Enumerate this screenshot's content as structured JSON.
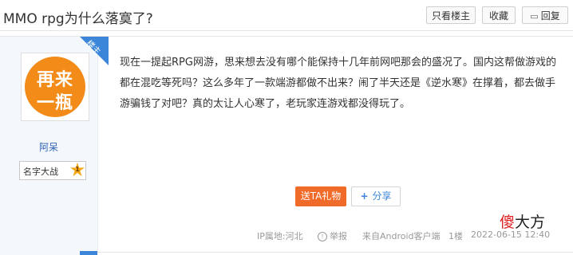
{
  "header": {
    "title": "MMO rpg为什么落寞了?",
    "buttons": {
      "only_host": "只看楼主",
      "favorite": "收藏",
      "reply": "回复"
    }
  },
  "author": {
    "ribbon": "楼主",
    "avatar_text_1": "再来",
    "avatar_text_2": "一瓶",
    "name": "阿呆",
    "badge_name": "名字大战",
    "badge_level": "1"
  },
  "post": {
    "content": "现在一提起RPG网游，思来想去没有哪个能保持十几年前网吧那会的盛况了。国内这帮做游戏的都在混吃等死吗？这么多年了一款端游都做不出来？闹了半天还是《逆水寒》在撑着，都去做手游骗钱了对吧？真的太让人心寒了，老玩家连游戏都没得玩了。",
    "gift_button": "送TA礼物",
    "share_button": "分享"
  },
  "footer": {
    "ip": "IP属地:河北",
    "report": "举报",
    "source": "来自Android客户端",
    "floor": "1楼",
    "date": "2022-06-15 12:40"
  },
  "watermark": {
    "red": "傻",
    "black": "大方"
  },
  "colors": {
    "accent": "#3b86d8",
    "gift": "#f06b2a",
    "avatar": "#f28b17"
  }
}
